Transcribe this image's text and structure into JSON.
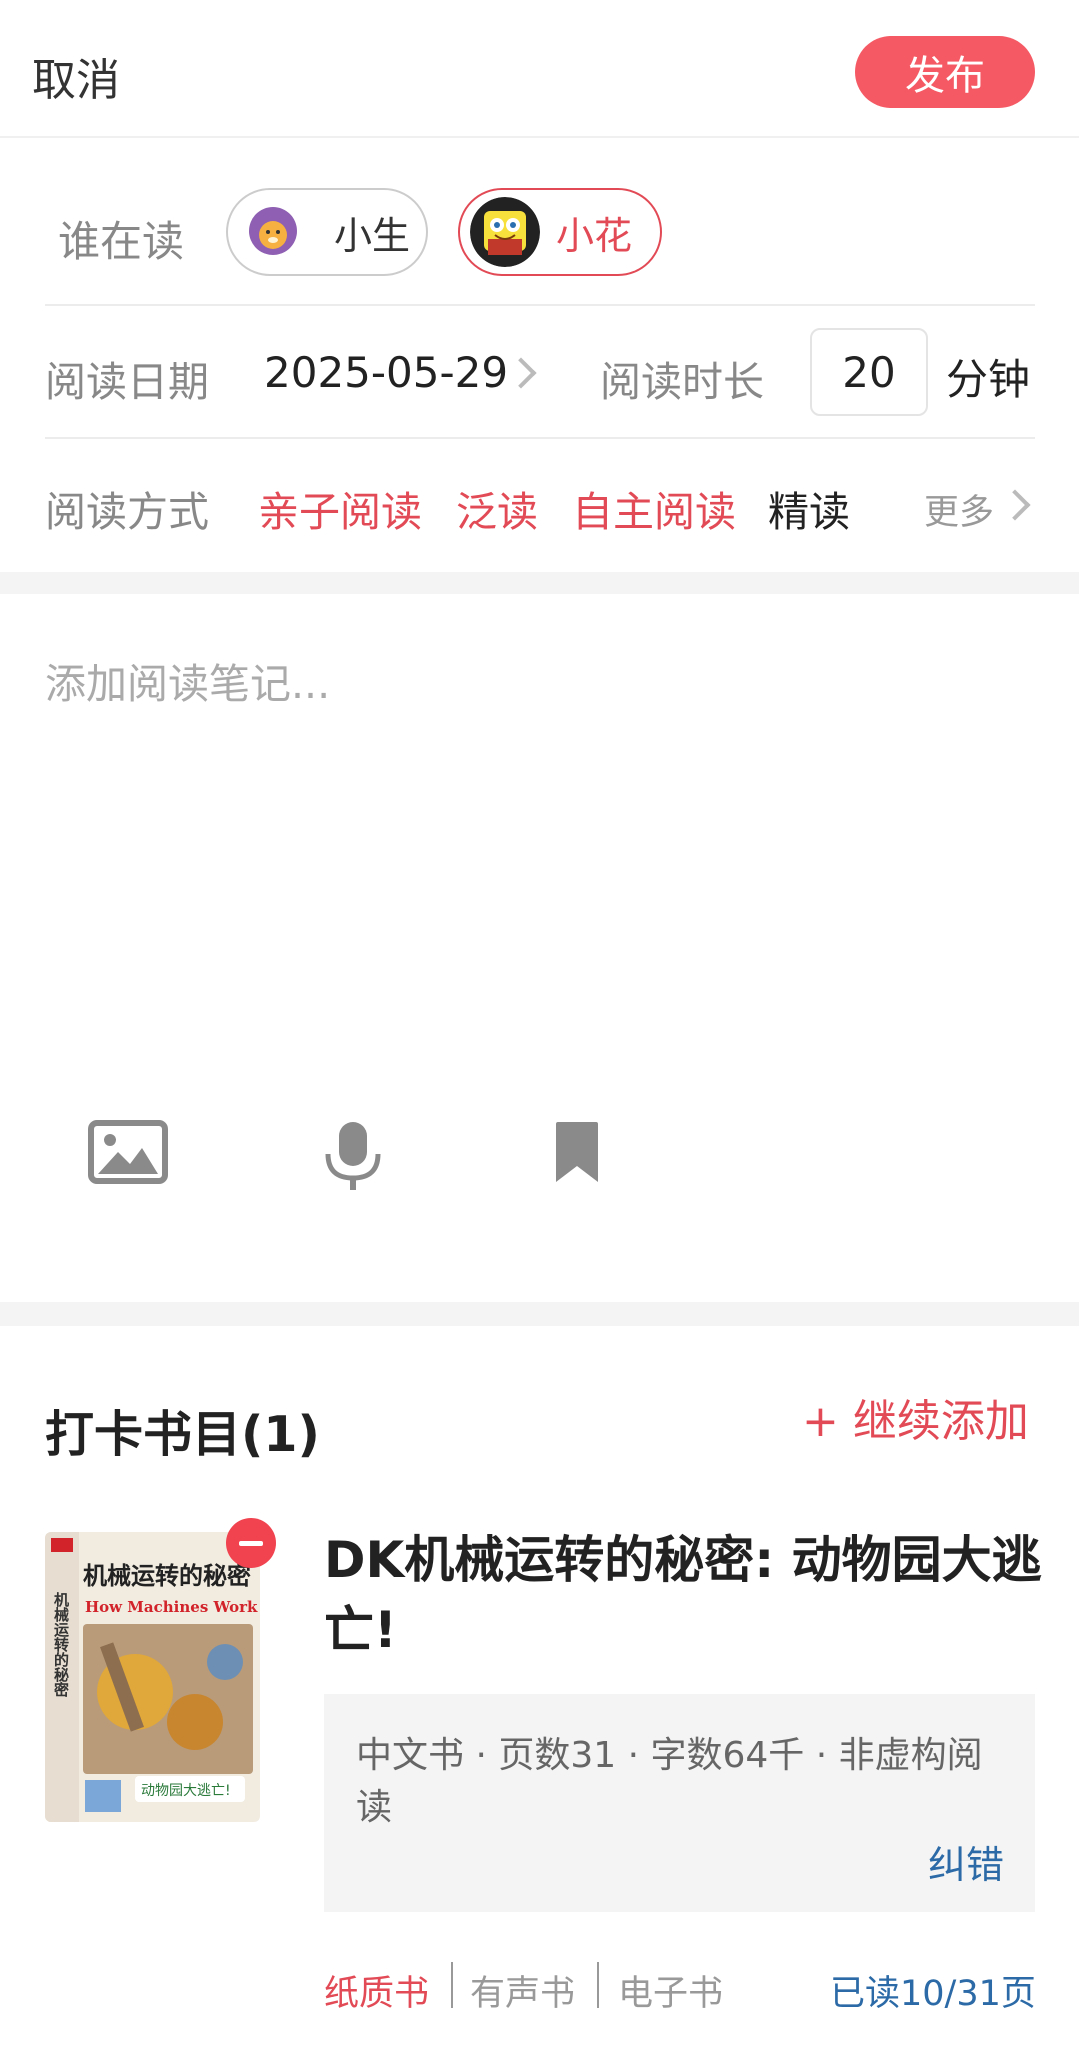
{
  "header": {
    "cancel": "取消",
    "publish": "发布"
  },
  "who": {
    "label": "谁在读",
    "readers": [
      {
        "name": "小生",
        "selected": false
      },
      {
        "name": "小花",
        "selected": true
      }
    ]
  },
  "date": {
    "label": "阅读日期",
    "value": "2025-05-29"
  },
  "duration": {
    "label": "阅读时长",
    "value": "20",
    "unit": "分钟"
  },
  "mode": {
    "label": "阅读方式",
    "options": [
      {
        "label": "亲子阅读",
        "selected": true
      },
      {
        "label": "泛读",
        "selected": true
      },
      {
        "label": "自主阅读",
        "selected": true
      },
      {
        "label": "精读",
        "selected": false
      }
    ],
    "more": "更多"
  },
  "note": {
    "placeholder": "添加阅读笔记..."
  },
  "tools": [
    "image-icon",
    "microphone-icon",
    "bookmark-icon"
  ],
  "books": {
    "title": "打卡书目(1)",
    "add_more": "+ 继续添加",
    "items": [
      {
        "title": "DK机械运转的秘密: 动物园大逃亡!",
        "info": "中文书 · 页数31 · 字数64千 · 非虚构阅读",
        "fix": "纠错",
        "formats": [
          {
            "label": "纸质书",
            "selected": true
          },
          {
            "label": "有声书",
            "selected": false
          },
          {
            "label": "电子书",
            "selected": false
          }
        ],
        "progress": "已读10/31页",
        "cover_text": "机械运转的秘密",
        "cover_text_en": "How Machines Work",
        "cover_text_side": "机械运转的秘密",
        "cover_text_sub": "动物园大逃亡!"
      }
    ]
  },
  "colors": {
    "accent": "#e24a55",
    "link": "#2b6aa6"
  }
}
